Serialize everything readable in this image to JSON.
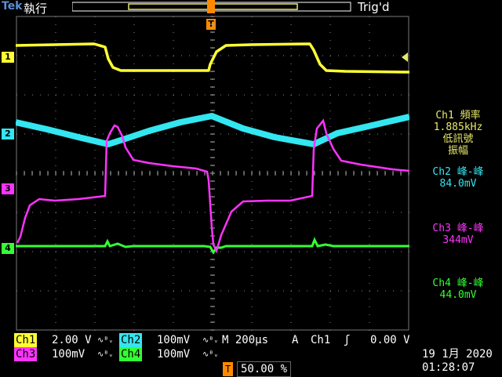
{
  "header": {
    "brand": "Tek",
    "mode": "執行",
    "trigger_state": "Trig'd",
    "trigger_marker": "T"
  },
  "channels": {
    "ch1": {
      "marker": "1",
      "color": "#ffff33"
    },
    "ch2": {
      "marker": "2",
      "color": "#33e6f0"
    },
    "ch3": {
      "marker": "3",
      "color": "#ff33ff"
    },
    "ch4": {
      "marker": "4",
      "color": "#33ff33"
    }
  },
  "measurements": [
    {
      "title": "Ch1 頻率",
      "value": "1.885kHz",
      "note1": "低訊號",
      "note2": "振幅",
      "color": "#e8e86a"
    },
    {
      "title": "Ch2 峰-峰",
      "value": "84.0mV",
      "color": "#33e6f0"
    },
    {
      "title": "Ch3 峰-峰",
      "value": "344mV",
      "color": "#ff33ff"
    },
    {
      "title": "Ch4 峰-峰",
      "value": "44.0mV",
      "color": "#33ff33"
    }
  ],
  "bottom": {
    "ch1_label": "Ch1",
    "ch1_scale": "2.00 V",
    "ch2_label": "Ch2",
    "ch2_scale": "100mV",
    "ch3_label": "Ch3",
    "ch3_scale": "100mV",
    "ch4_label": "Ch4",
    "ch4_scale": "100mV",
    "bw_symbol": "∿ᴮᵥ",
    "timebase": "M 200µs",
    "trigger_mode": "A",
    "trigger_source": "Ch1",
    "trigger_slope": "ʃ",
    "trigger_level": "0.00 V",
    "trigger_position": "50.00 %"
  },
  "clock": {
    "date": "19 1月  2020",
    "time": "01:28:07"
  }
}
